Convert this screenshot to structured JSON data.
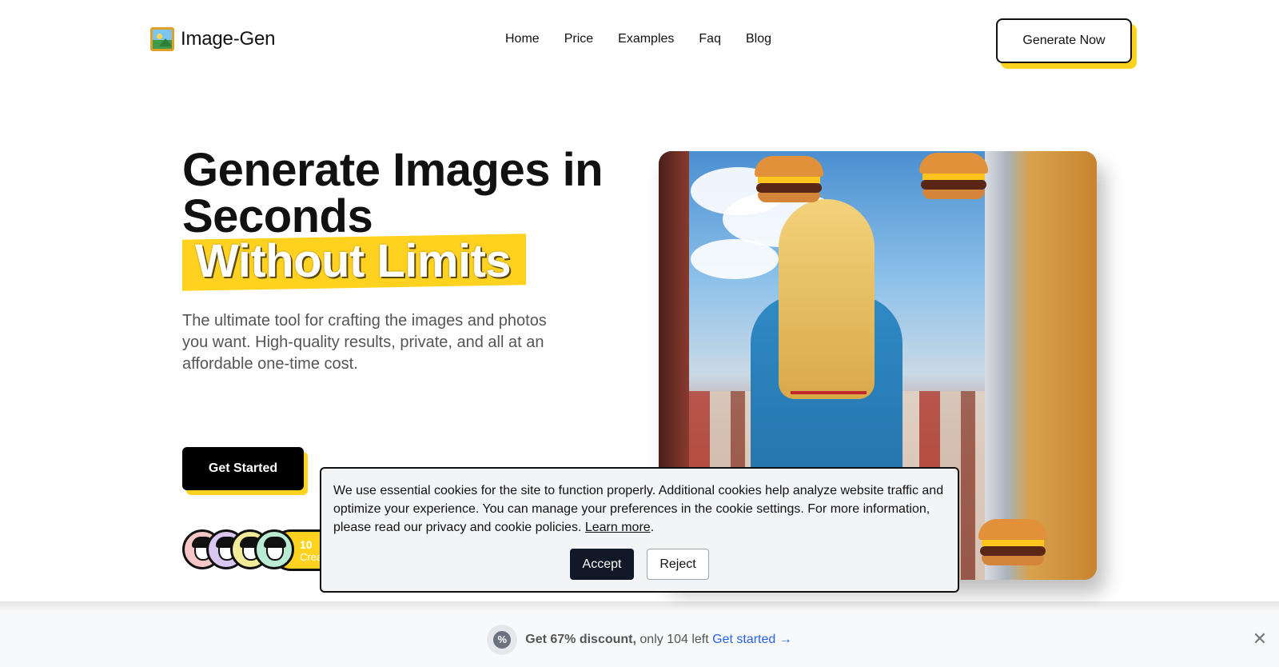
{
  "header": {
    "logo_text": "Image-Gen",
    "logo_icon": "framed-picture-icon",
    "nav": [
      "Home",
      "Price",
      "Examples",
      "Faq",
      "Blog"
    ],
    "cta_label": "Generate Now"
  },
  "hero": {
    "title_line1": "Generate Images in",
    "title_line2": "Seconds",
    "highlight": "Without Limits",
    "subtitle": "The ultimate tool for crafting the images and photos you want. High-quality results, private, and all at an affordable one-time cost.",
    "cta_label": "Get Started",
    "creators_count": "10",
    "creators_label": "Crea"
  },
  "cookie": {
    "text": "We use essential cookies for the site to function properly. Additional cookies help analyze website traffic and optimize your experience. You can manage your preferences in the cookie settings. For more information, please read our privacy and cookie policies.",
    "learn_more": "Learn more",
    "period": ".",
    "accept": "Accept",
    "reject": "Reject"
  },
  "promo": {
    "icon": "percent-badge-icon",
    "bold": "Get 67% discount,",
    "text": "only 104 left",
    "link": "Get started →",
    "close": "✕"
  },
  "colors": {
    "accent": "#ffd21f",
    "dark": "#111111",
    "accept_bg": "#111827",
    "link": "#2563eb"
  }
}
